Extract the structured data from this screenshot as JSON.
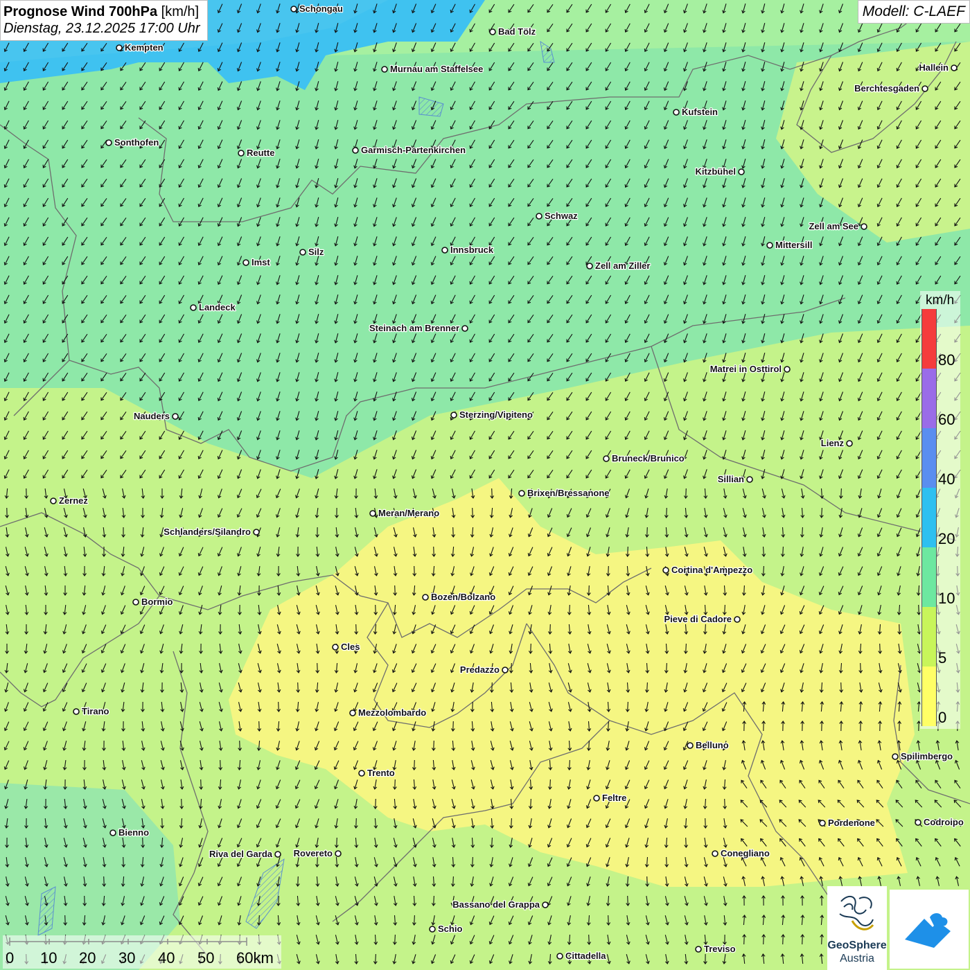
{
  "title": {
    "main_bold": "Prognose Wind 700hPa",
    "unit": "[km/h]",
    "date": "Dienstag, 23.12.2025 17:00 Uhr"
  },
  "model": "Modell: C-LAEF",
  "legend": {
    "unit": "km/h",
    "labels": [
      "80",
      "60",
      "40",
      "20",
      "10",
      "5",
      "0"
    ],
    "colors": [
      "#f53c3c",
      "#9a6ce8",
      "#5a8ef0",
      "#2ec0f0",
      "#6de8a0",
      "#c8f55a",
      "#ffff66"
    ]
  },
  "scalebar": {
    "labels": [
      "0",
      "10",
      "20",
      "30",
      "40",
      "50",
      "60km"
    ]
  },
  "logo": {
    "line1": "GeoSphere",
    "line2": "Austria"
  },
  "cities": [
    {
      "name": "Schongau"
    },
    {
      "name": "Bad Tölz"
    },
    {
      "name": "Kempten"
    },
    {
      "name": "Murnau am Staffelsee"
    },
    {
      "name": "Hallein"
    },
    {
      "name": "Berchtesgaden"
    },
    {
      "name": "Kufstein"
    },
    {
      "name": "Sonthofen"
    },
    {
      "name": "Reutte"
    },
    {
      "name": "Garmisch-Partenkirchen"
    },
    {
      "name": "Kitzbühel"
    },
    {
      "name": "Schwaz"
    },
    {
      "name": "Zell am See"
    },
    {
      "name": "Mittersill"
    },
    {
      "name": "Innsbruck"
    },
    {
      "name": "Silz"
    },
    {
      "name": "Imst"
    },
    {
      "name": "Zell am Ziller"
    },
    {
      "name": "Landeck"
    },
    {
      "name": "Steinach am Brenner"
    },
    {
      "name": "Matrei in Osttirol"
    },
    {
      "name": "Nauders"
    },
    {
      "name": "Sterzing/Vipiteno"
    },
    {
      "name": "Lienz"
    },
    {
      "name": "Bruneck/Brunico"
    },
    {
      "name": "Sillian"
    },
    {
      "name": "Zernez"
    },
    {
      "name": "Brixen/Bressanone"
    },
    {
      "name": "Meran/Merano"
    },
    {
      "name": "Schlanders/Silandro"
    },
    {
      "name": "Cortina d'Ampezzo"
    },
    {
      "name": "Bozen/Bolzano"
    },
    {
      "name": "Bormio"
    },
    {
      "name": "Pieve di Cadore"
    },
    {
      "name": "Cles"
    },
    {
      "name": "Predazzo"
    },
    {
      "name": "Tirano"
    },
    {
      "name": "Mezzolombardo"
    },
    {
      "name": "Belluno"
    },
    {
      "name": "Spilimbergo"
    },
    {
      "name": "Trento"
    },
    {
      "name": "Feltre"
    },
    {
      "name": "Pordenone"
    },
    {
      "name": "Codroipo"
    },
    {
      "name": "Bienno"
    },
    {
      "name": "Riva del Garda"
    },
    {
      "name": "Rovereto"
    },
    {
      "name": "Conegliano"
    },
    {
      "name": "Bassano del Grappa"
    },
    {
      "name": "Schio"
    },
    {
      "name": "Treviso"
    },
    {
      "name": "Cittadella"
    }
  ]
}
